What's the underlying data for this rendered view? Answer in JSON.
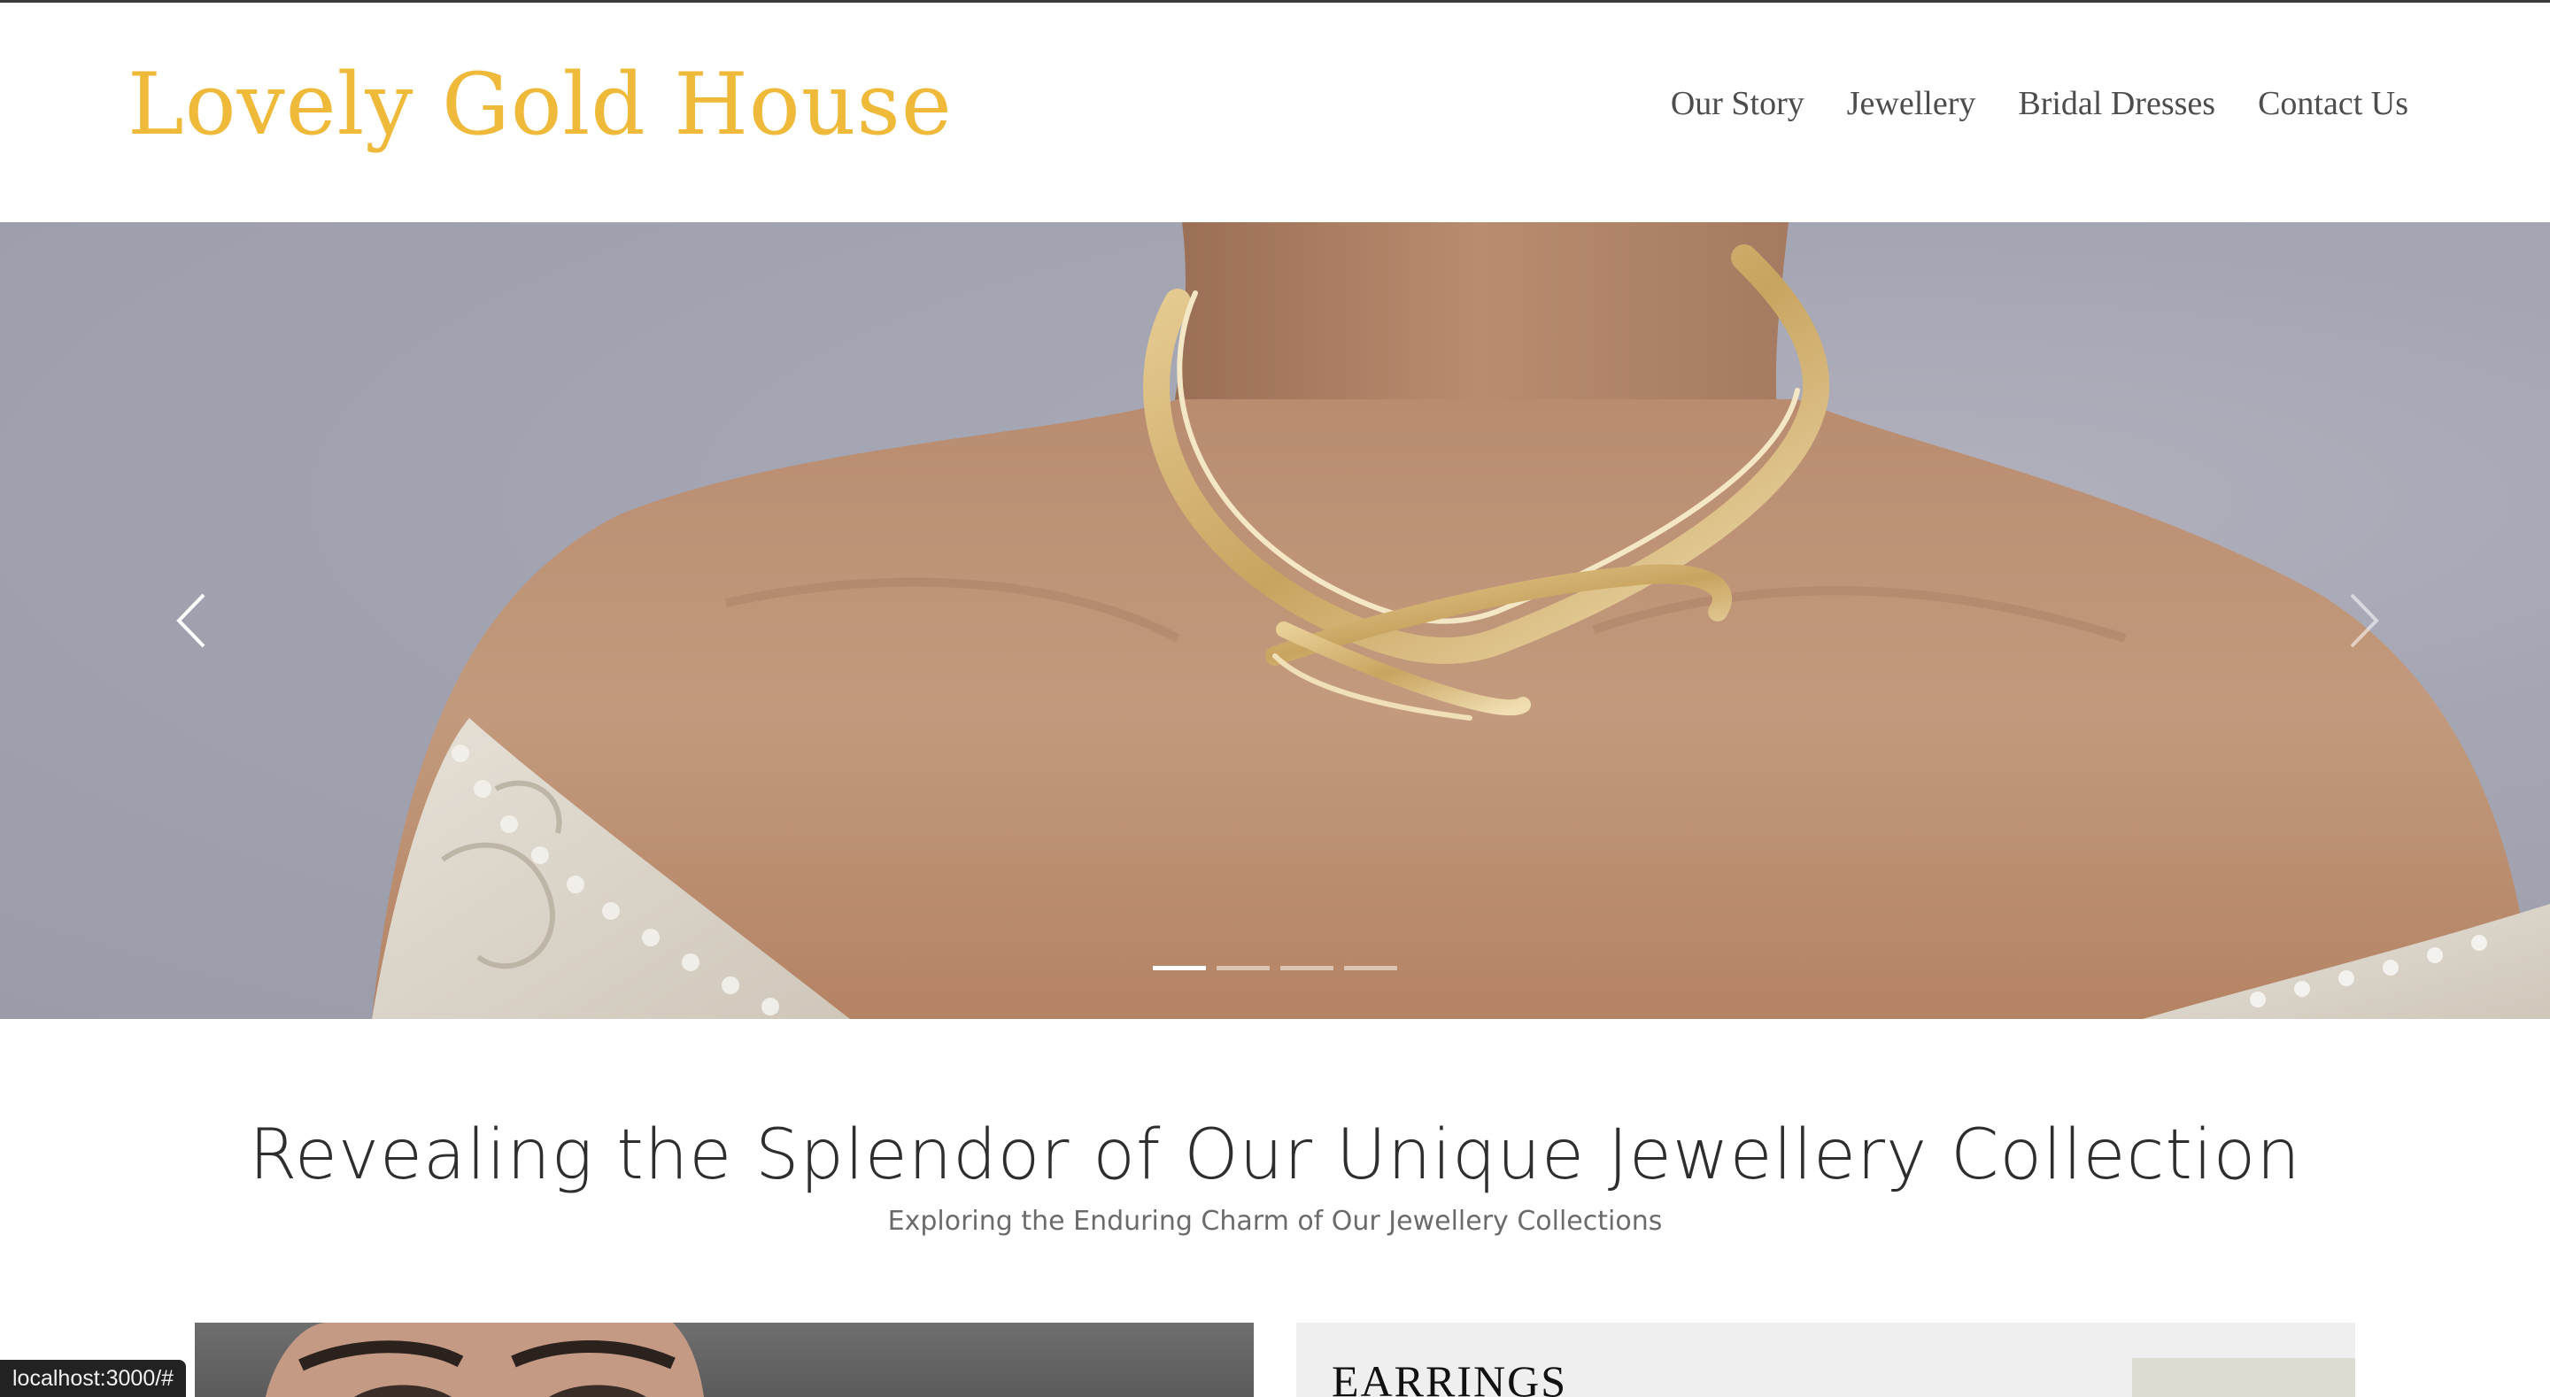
{
  "brand": {
    "logo_text": "Lovely Gold House",
    "accent_color": "#efb93a"
  },
  "nav": {
    "items": [
      "Our Story",
      "Jewellery",
      "Bridal Dresses",
      "Contact Us"
    ]
  },
  "carousel": {
    "prev_icon": "chevron-left-icon",
    "next_icon": "chevron-right-icon",
    "slide_count": 4,
    "active_index": 0
  },
  "intro": {
    "title": "Revealing the Splendor of Our Unique Jewellery Collection",
    "subtitle": "Exploring the Enduring Charm of Our Jewellery Collections"
  },
  "collections": {
    "earrings_title": "EARRINGS"
  },
  "statusbar": {
    "url": "localhost:3000/#"
  }
}
